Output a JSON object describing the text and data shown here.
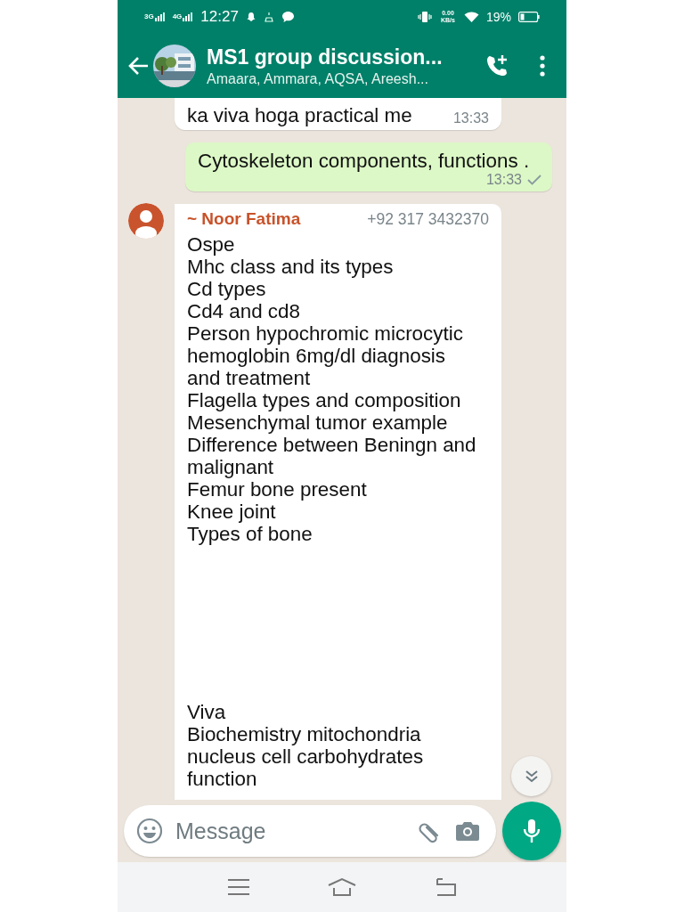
{
  "status_bar": {
    "networks": [
      "3G",
      "4G"
    ],
    "time": "12:27",
    "speed": "0.00 KB/s",
    "battery": "19%"
  },
  "header": {
    "title": "MS1 group discussion...",
    "members": "Amaara, Ammara, AQSA, Areesh..."
  },
  "messages": [
    {
      "kind": "incoming_tail",
      "text": "ka viva hoga practical me",
      "time": "13:33"
    },
    {
      "kind": "outgoing",
      "text": "Cytoskeleton components, functions .",
      "time": "13:33"
    },
    {
      "kind": "incoming",
      "sender": "~ Noor Fatima",
      "phone": "+92 317 3432370",
      "paragraphs": [
        "Ospe\nMhc class and its types\nCd types\nCd4 and cd8\nPerson hypochromic microcytic hemoglobin 6mg/dl diagnosis and treatment\nFlagella types and composition\nMesenchymal tumor example\nDifference between Beningn and malignant\nFemur bone present\nKnee joint\nTypes of bone",
        "Viva\nBiochemistry mitochondria nucleus cell carbohydrates function"
      ]
    }
  ],
  "composer": {
    "placeholder": "Message"
  }
}
